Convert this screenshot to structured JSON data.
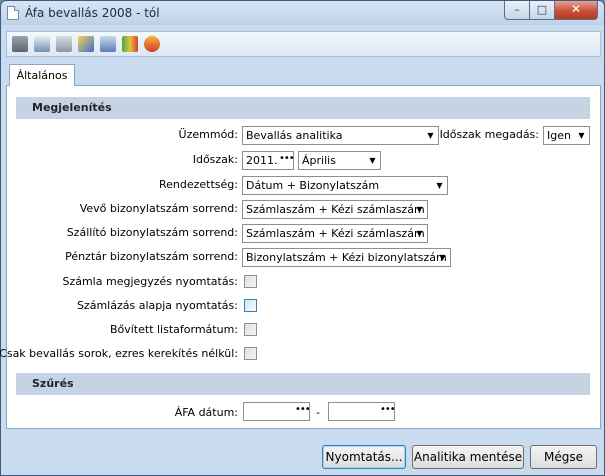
{
  "window": {
    "title": "Áfa bevallás 2008 - tól",
    "minimize_glyph": "–",
    "maximize_glyph": "□",
    "close_glyph": "✕"
  },
  "toolbar": {
    "icons": [
      "print-icon",
      "print-preview-icon",
      "copy-icon",
      "edit-icon",
      "calculator-icon",
      "export-icon",
      "info-icon"
    ]
  },
  "tabs": [
    {
      "label": "Általános"
    }
  ],
  "sections": {
    "display": {
      "title": "Megjelenítés",
      "mode_label": "Üzemmód:",
      "mode_value": "Bevallás analitika",
      "period_entry_label": "Időszak megadás:",
      "period_entry_value": "Igen",
      "period_label": "Időszak:",
      "period_year": "2011.",
      "period_month": "Április",
      "ordering_label": "Rendezettség:",
      "ordering_value": "Dátum + Bizonylatszám",
      "customer_order_label": "Vevő bizonylatszám sorrend:",
      "customer_order_value": "Számlaszám + Kézi számlaszám",
      "supplier_order_label": "Szállító bizonylatszám sorrend:",
      "supplier_order_value": "Számlaszám + Kézi számlaszám",
      "cash_order_label": "Pénztár bizonylatszám sorrend:",
      "cash_order_value": "Bizonylatszám + Kézi bizonylatszám",
      "print_invoice_note_label": "Számla megjegyzés nyomtatás:",
      "print_invoice_note_checked": false,
      "print_billing_basis_label": "Számlázás alapja nyomtatás:",
      "print_billing_basis_checked": false,
      "extended_list_label": "Bővített listaformátum:",
      "extended_list_checked": false,
      "only_vat_rows_label": "Csak bevallás sorok, ezres kerekítés nélkül:",
      "only_vat_rows_checked": false
    },
    "filter": {
      "title": "Szűrés",
      "vat_date_label": "ÁFA dátum:",
      "vat_date_from": "",
      "vat_date_to": "",
      "range_separator": "-"
    }
  },
  "buttons": {
    "print": "Nyomtatás...",
    "save_analytics": "Analitika mentése",
    "cancel": "Mégse"
  },
  "dropdown_arrow": "▼",
  "ellipsis": "•••"
}
